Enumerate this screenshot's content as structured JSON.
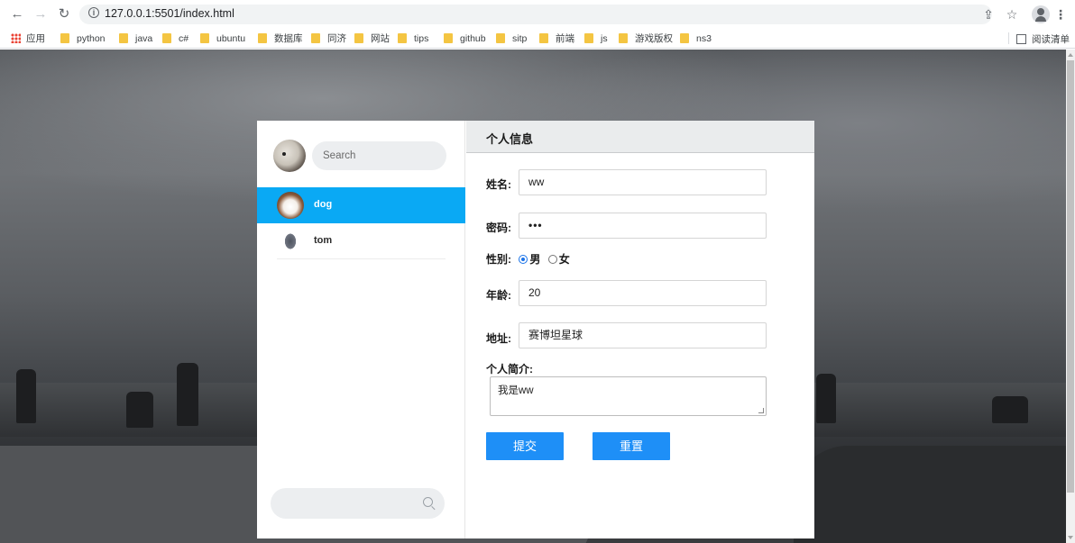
{
  "browser": {
    "url": "127.0.0.1:5501/index.html",
    "bookmarks": [
      {
        "label": "应用",
        "type": "apps"
      },
      {
        "label": "python"
      },
      {
        "label": "java"
      },
      {
        "label": "c#"
      },
      {
        "label": "ubuntu"
      },
      {
        "label": "数据库"
      },
      {
        "label": "同济"
      },
      {
        "label": "网站"
      },
      {
        "label": "tips"
      },
      {
        "label": "github"
      },
      {
        "label": "sitp"
      },
      {
        "label": "前端"
      },
      {
        "label": "js"
      },
      {
        "label": "游戏版权"
      },
      {
        "label": "ns3"
      }
    ],
    "reading_list": "阅读清单"
  },
  "sidebar": {
    "search_placeholder": "Search",
    "contacts": [
      {
        "name": "dog",
        "active": true
      },
      {
        "name": "tom",
        "active": false
      }
    ]
  },
  "profile": {
    "title": "个人信息",
    "name_label": "姓名:",
    "name_value": "ww",
    "password_label": "密码:",
    "password_value": "•••",
    "gender_label": "性别:",
    "gender_options": [
      "男",
      "女"
    ],
    "gender_selected": "男",
    "age_label": "年龄:",
    "age_value": "20",
    "address_label": "地址:",
    "address_value": "赛博坦星球",
    "bio_label": "个人简介:",
    "bio_value": "我是ww",
    "submit_label": "提交",
    "reset_label": "重置"
  }
}
